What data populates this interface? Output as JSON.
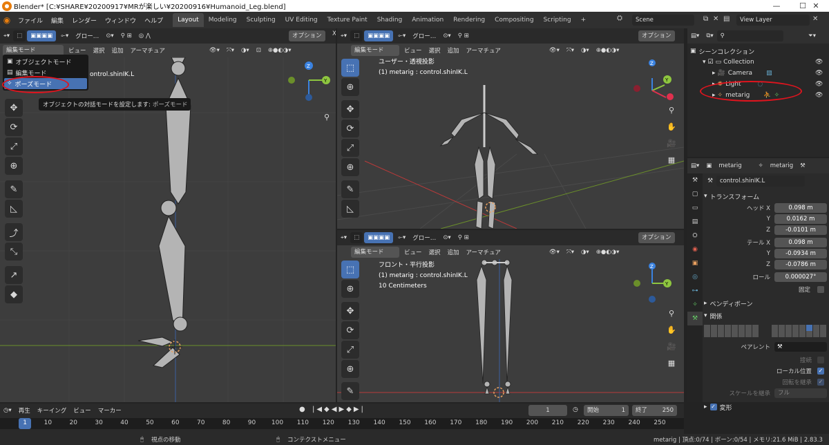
{
  "title": "Blender* [C:¥SHARE¥20200917¥MRが楽しい¥20200916¥Humanoid_Leg.blend]",
  "window_controls": [
    "—",
    "☐",
    "✕"
  ],
  "menu": [
    "ファイル",
    "編集",
    "レンダー",
    "ウィンドウ",
    "ヘルプ"
  ],
  "workspaces": [
    "Layout",
    "Modeling",
    "Sculpting",
    "UV Editing",
    "Texture Paint",
    "Shading",
    "Animation",
    "Rendering",
    "Compositing",
    "Scripting",
    "+"
  ],
  "scene": "Scene",
  "view_layer": "View Layer",
  "header": {
    "global": "グロー…",
    "global_full": "グロー…",
    "options": "オプション",
    "mode": "編集モード",
    "view": "ビュー",
    "select": "選択",
    "add": "追加",
    "armature": "アーマチュア"
  },
  "mode_dropdown": {
    "items": [
      "オブジェクトモード",
      "編集モード",
      "ポーズモード"
    ],
    "selected": "ポーズモード",
    "tooltip_label": "オブジェクトの対話モードを設定します:",
    "tooltip_value": "ポーズモード",
    "partial_info": "ontrol.shinIK.L"
  },
  "viewport_user": {
    "line1": "ユーザー・透視投影",
    "line2": "(1) metarig : control.shinIK.L"
  },
  "viewport_front": {
    "line1": "フロント・平行投影",
    "line2": "(1) metarig : control.shinIK.L",
    "line3": "10 Centimeters"
  },
  "outliner": {
    "root": "シーンコレクション",
    "collection": "Collection",
    "items": [
      "Camera",
      "Light",
      "metarig"
    ]
  },
  "properties": {
    "object_name": "metarig",
    "armature_name": "metarig",
    "bone_name": "control.shinIK.L",
    "transform_title": "トランスフォーム",
    "head_label": "ヘッド X",
    "tail_label": "テール X",
    "y_label": "Y",
    "z_label": "Z",
    "head": [
      "0.098 m",
      "0.0162 m",
      "-0.0101 m"
    ],
    "tail": [
      "0.098 m",
      "-0.0934 m",
      "-0.0786 m"
    ],
    "roll_label": "ロール",
    "roll": "0.000027°",
    "lock_label": "固定",
    "bendy_title": "ベンディボーン",
    "relations_title": "関係",
    "parent_label": "ペアレント",
    "connect_label": "接続",
    "local_location_label": "ローカル位置",
    "inherit_rotation_label": "回転を継承",
    "inherit_scale_label": "スケールを継承",
    "inherit_scale_value": "フル",
    "deform_title": "変形"
  },
  "timeline": {
    "playback": "再生",
    "keying": "キーイング",
    "view": "ビュー",
    "marker": "マーカー",
    "current_frame": "1",
    "start_label": "開始",
    "start": "1",
    "end_label": "終了",
    "end": "250",
    "ticks": [
      "1",
      "10",
      "20",
      "30",
      "40",
      "50",
      "60",
      "70",
      "80",
      "90",
      "100",
      "110",
      "120",
      "130",
      "140",
      "150",
      "160",
      "170",
      "180",
      "190",
      "200",
      "210",
      "220",
      "230",
      "240",
      "250"
    ]
  },
  "statusbar": {
    "left": "視点の移動",
    "middle": "コンテクストメニュー",
    "right": "metarig | 頂点:0/74 | ボーン:0/54 | メモリ:21.6 MiB | 2.83.3"
  },
  "colors": {
    "accent": "#4772b3",
    "annotation": "#e0141e",
    "axis_x": "#e0304e",
    "axis_y": "#8ec63f",
    "axis_z": "#3a82e0",
    "bone": "#b4b4b4"
  }
}
